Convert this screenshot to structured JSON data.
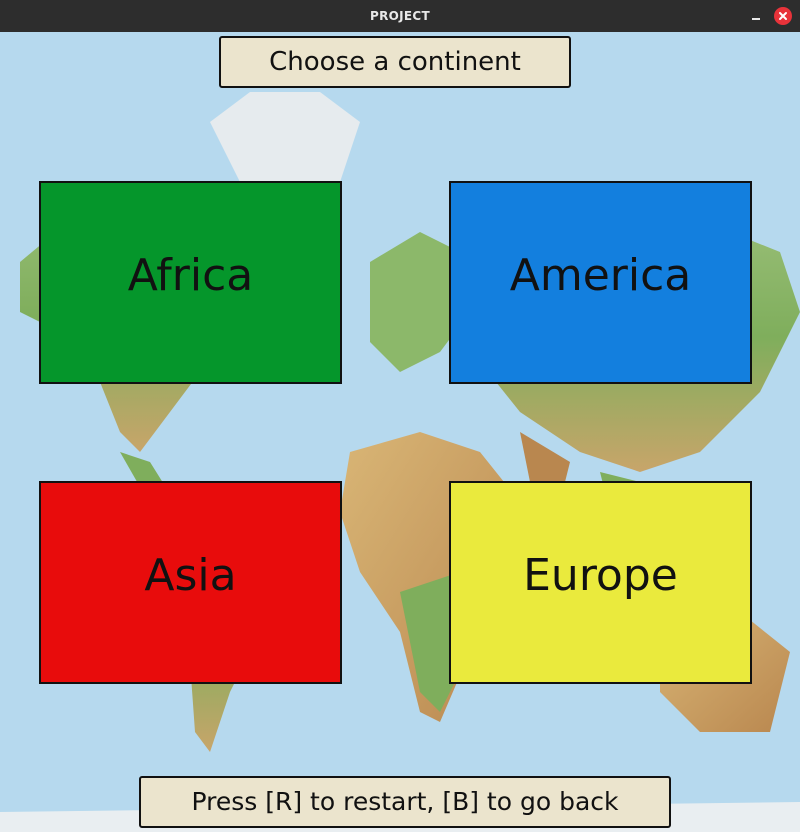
{
  "window": {
    "title": "PROJECT"
  },
  "header": {
    "prompt": "Choose a continent"
  },
  "continents": [
    {
      "label": "Africa",
      "color": "#05962b"
    },
    {
      "label": "America",
      "color": "#137fde"
    },
    {
      "label": "Asia",
      "color": "#e80c0c"
    },
    {
      "label": "Europe",
      "color": "#eaea3d"
    }
  ],
  "footer": {
    "hint": "Press [R] to restart, [B] to go back"
  },
  "colors": {
    "ocean": "#b6d9ee",
    "land": "#8fb86a",
    "banner": "#ebe4cd"
  }
}
